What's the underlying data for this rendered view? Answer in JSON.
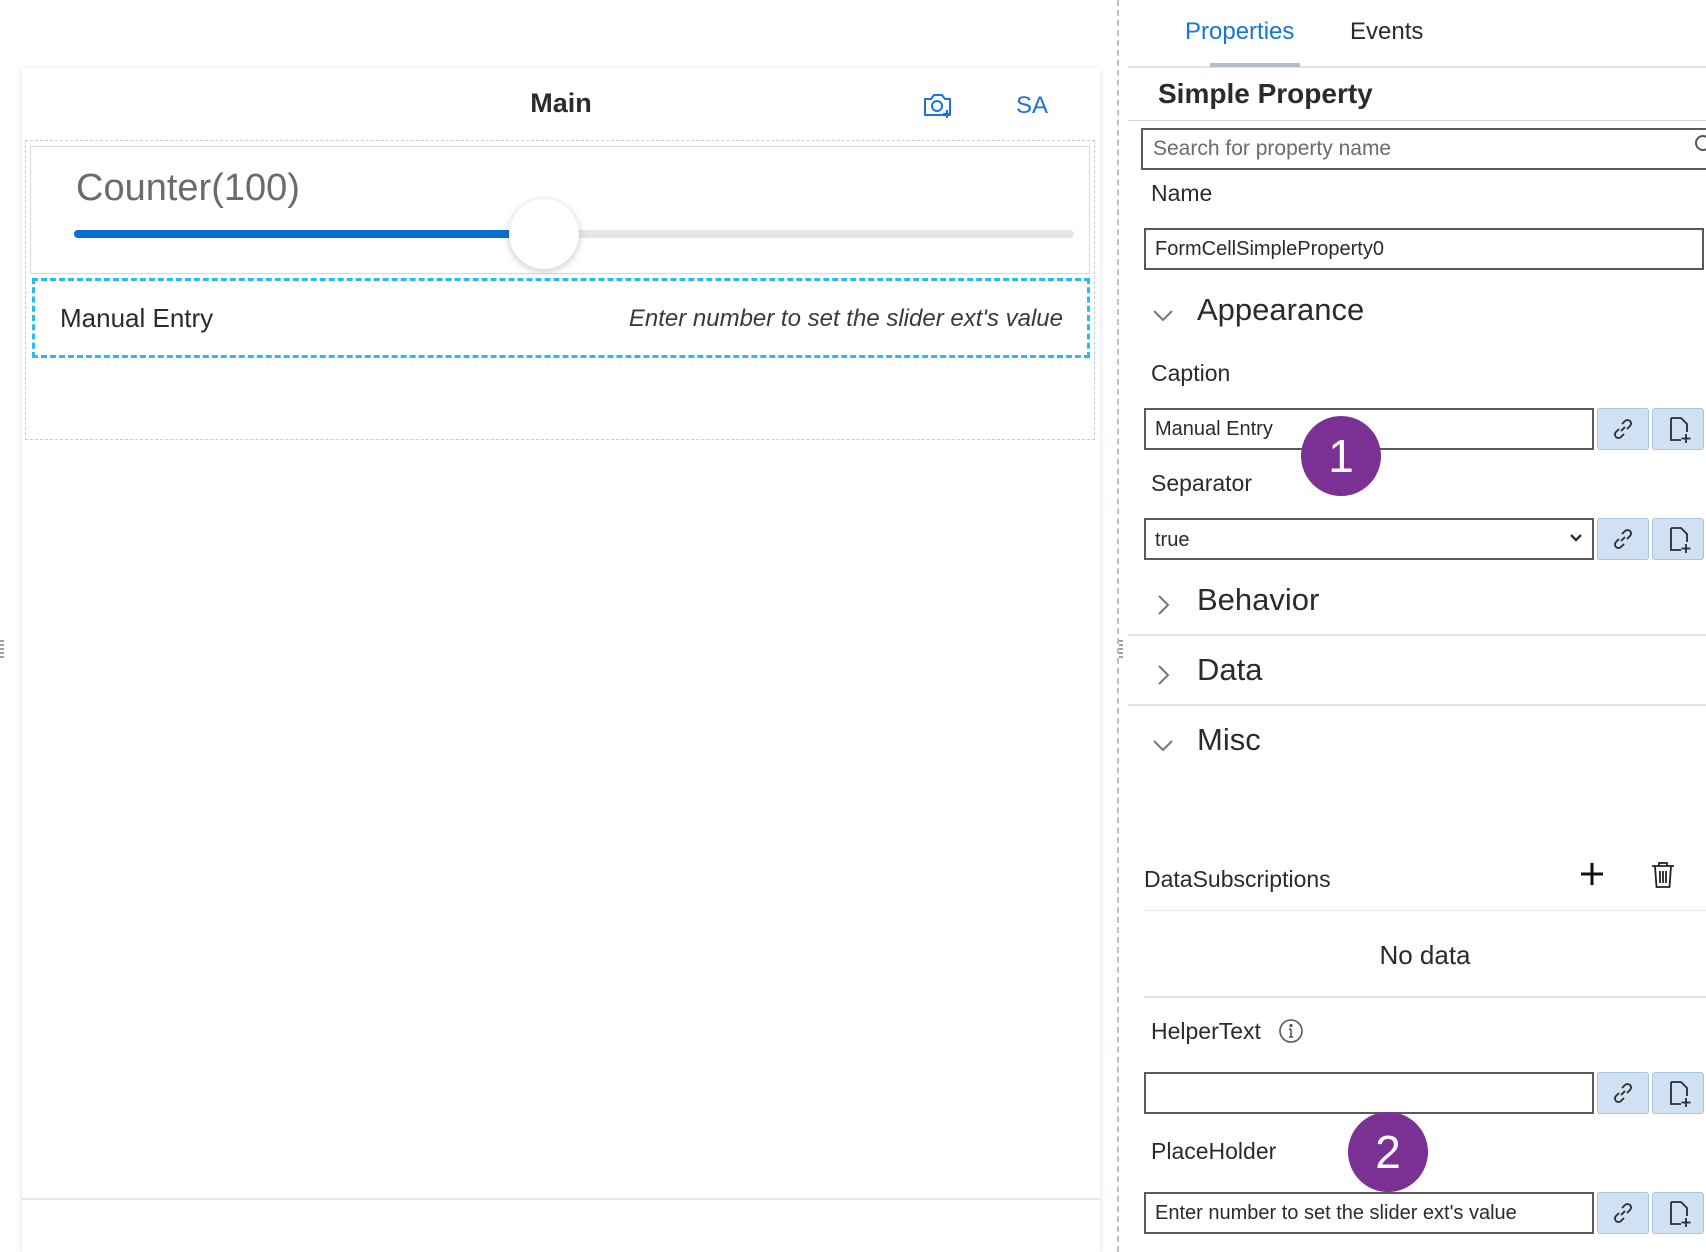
{
  "preview": {
    "header": {
      "title": "Main",
      "camera_icon": "camera-plus-icon",
      "sa_label": "SA"
    },
    "slider_cell": {
      "caption": "Counter(100)",
      "value_fraction": 0.47
    },
    "entry_cell": {
      "caption": "Manual Entry",
      "placeholder": "Enter number to set the slider ext's value"
    }
  },
  "panel": {
    "tabs": [
      {
        "label": "Properties",
        "active": true
      },
      {
        "label": "Events",
        "active": false
      }
    ],
    "section_title": "Simple Property",
    "search_placeholder": "Search for property name",
    "name_label": "Name",
    "name_value": "FormCellSimpleProperty0",
    "groups": {
      "appearance": "Appearance",
      "behavior": "Behavior",
      "data": "Data",
      "misc": "Misc"
    },
    "caption_label": "Caption",
    "caption_value": "Manual Entry",
    "separator_label": "Separator",
    "separator_value": "true",
    "data_subscriptions_label": "DataSubscriptions",
    "no_data": "No data",
    "helper_text_label": "HelperText",
    "helper_text_value": "",
    "placeholder_label": "PlaceHolder",
    "placeholder_value": "Enter number to set the slider ext's value"
  },
  "badges": {
    "one": "1",
    "two": "2"
  },
  "colors": {
    "accent": "#1a73d9",
    "slider_fill": "#0a6ed1",
    "selection_outline": "#29bce8",
    "badge": "#7b3193",
    "icon_button_bg": "#cfe1f3"
  }
}
